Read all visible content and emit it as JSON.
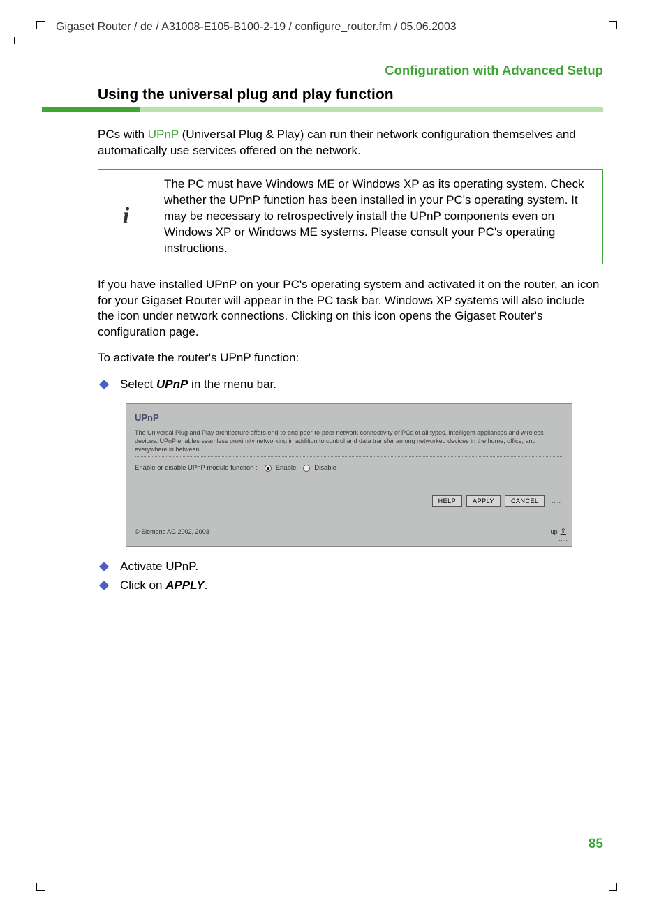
{
  "header_path": "Gigaset Router / de / A31008-E105-B100-2-19 / configure_router.fm / 05.06.2003",
  "section_title": "Configuration with Advanced Setup",
  "heading": "Using the universal plug and play function",
  "intro_pre": "PCs with ",
  "intro_link": "UPnP",
  "intro_post": " (Universal Plug & Play) can run their network configuration themselves and automatically use services offered on the network.",
  "info_icon": "i",
  "info_text": "The PC must have Windows ME or Windows XP as its operating system. Check whether the UPnP function has been installed in your PC's operating system. It may be necessary to retrospectively install the UPnP components even on Windows XP or Windows ME systems. Please consult your PC's operating instructions.",
  "para2": "If you have installed UPnP on your PC's operating system and activated it on the router, an icon for your Gigaset Router will appear in the PC task bar. Windows XP systems will also include the icon under network connections. Clicking on this icon opens the Gigaset Router's configuration page.",
  "para3": "To activate the router's UPnP function:",
  "bullet1_pre": "Select ",
  "bullet1_bold": "UPnP",
  "bullet1_post": " in the menu bar.",
  "screenshot": {
    "title": "UPnP",
    "desc": "The Universal Plug and Play architecture offers end-to-end peer-to-peer network connectivity of PCs of all types, intelligent appliances and wireless devices. UPnP enables seamless proximity networking in addition to control and data transfer among networked devices in the home, office, and everywhere in between.",
    "radio_label": "Enable or disable UPnP module function :",
    "opt_enable": "Enable",
    "opt_disable": "Disable",
    "btn_help": "HELP",
    "btn_apply": "APPLY",
    "btn_cancel": "CANCEL",
    "copyright": "© Siemens AG 2002, 2003",
    "up_label": "up"
  },
  "bullet2": "Activate UPnP.",
  "bullet3_pre": "Click on ",
  "bullet3_bold": "APPLY",
  "bullet3_post": ".",
  "page_number": "85"
}
